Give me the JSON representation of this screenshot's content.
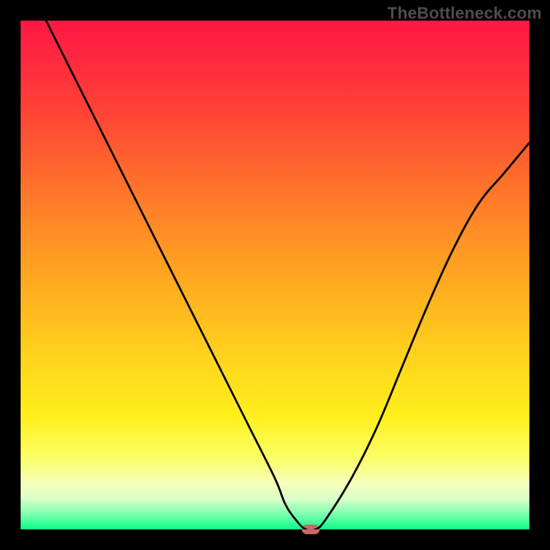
{
  "watermark": "TheBottleneck.com",
  "chart_data": {
    "type": "line",
    "title": "",
    "xlabel": "",
    "ylabel": "",
    "xlim": [
      0,
      100
    ],
    "ylim": [
      0,
      100
    ],
    "series": [
      {
        "name": "curve",
        "x": [
          5,
          10,
          15,
          20,
          25,
          30,
          35,
          40,
          45,
          50,
          52,
          54,
          56,
          58,
          60,
          65,
          70,
          75,
          80,
          85,
          90,
          95,
          100
        ],
        "values": [
          100,
          90,
          80,
          70,
          60,
          50,
          40,
          30,
          20,
          10,
          5,
          2,
          0,
          0,
          2,
          10,
          20,
          32,
          44,
          55,
          64,
          70,
          76
        ]
      }
    ],
    "marker": {
      "x": 57,
      "y": 0,
      "color": "#c76a63"
    },
    "gradient_stops": [
      {
        "pos": 0,
        "color": "#ff1744"
      },
      {
        "pos": 50,
        "color": "#ffb41f"
      },
      {
        "pos": 80,
        "color": "#fff01c"
      },
      {
        "pos": 100,
        "color": "#0bff89"
      }
    ]
  }
}
